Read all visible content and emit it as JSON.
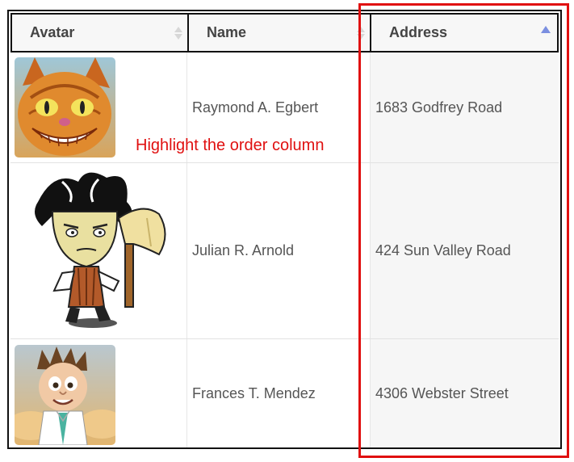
{
  "table": {
    "columns": [
      {
        "label": "Avatar",
        "sort": "both"
      },
      {
        "label": "Name",
        "sort": "both"
      },
      {
        "label": "Address",
        "sort": "ascending"
      }
    ],
    "rows": [
      {
        "avatar": "cartoon-cat-avatar",
        "name": "Raymond A. Egbert",
        "address": "1683 Godfrey Road"
      },
      {
        "avatar": "cartoon-man-with-axe-avatar",
        "name": "Julian R. Arnold",
        "address": "424 Sun Valley Road"
      },
      {
        "avatar": "cartoon-boy-avatar",
        "name": "Frances T. Mendez",
        "address": "4306 Webster Street"
      }
    ]
  },
  "annotation": {
    "text": "Highlight the order column",
    "color": "#e01010"
  },
  "colors": {
    "sort_active": "#7b8fe0",
    "highlight": "#e01010"
  }
}
